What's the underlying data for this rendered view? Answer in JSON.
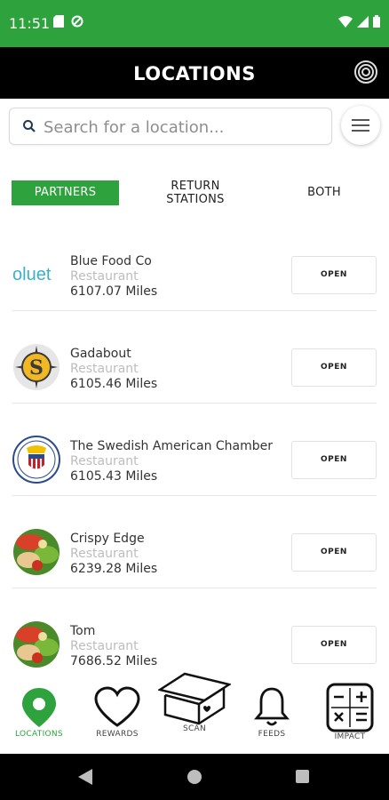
{
  "status_bar": {
    "time": "11:51"
  },
  "header": {
    "title": "LOCATIONS"
  },
  "search": {
    "placeholder": "Search for a location..."
  },
  "tabs": [
    {
      "label": "PARTNERS",
      "active": true
    },
    {
      "label": "RETURN\nSTATIONS",
      "active": false
    },
    {
      "label": "BOTH",
      "active": false
    }
  ],
  "locations": [
    {
      "name": "Blue Food Co",
      "type": "Restaurant",
      "distance": "6107.07 Miles",
      "button": "OPEN",
      "logo": "oluet-logo"
    },
    {
      "name": "Gadabout",
      "type": "Restaurant",
      "distance": "6105.46 Miles",
      "button": "OPEN",
      "logo": "gadabout-logo"
    },
    {
      "name": "The Swedish American Chamber",
      "type": "Restaurant",
      "distance": "6105.43 Miles",
      "button": "OPEN",
      "logo": "chamber-seal-logo"
    },
    {
      "name": "Crispy Edge",
      "type": "Restaurant",
      "distance": "6239.28 Miles",
      "button": "OPEN",
      "logo": "salad-food-photo"
    },
    {
      "name": "Tom",
      "type": "Restaurant",
      "distance": "7686.52 Miles",
      "button": "OPEN",
      "logo": "salad-food-photo"
    }
  ],
  "bottom_nav": [
    {
      "label": "LOCATIONS",
      "icon": "location-pin-icon",
      "active": true
    },
    {
      "label": "REWARDS",
      "icon": "heart-icon",
      "active": false
    },
    {
      "label": "SCAN",
      "icon": "container-box-icon",
      "active": false
    },
    {
      "label": "FEEDS",
      "icon": "bell-icon",
      "active": false
    },
    {
      "label": "IMPACT",
      "icon": "calculator-icon",
      "active": false
    }
  ],
  "colors": {
    "accent": "#2ea23c",
    "header_bg": "#000000",
    "muted_text": "#bdbdbd"
  }
}
